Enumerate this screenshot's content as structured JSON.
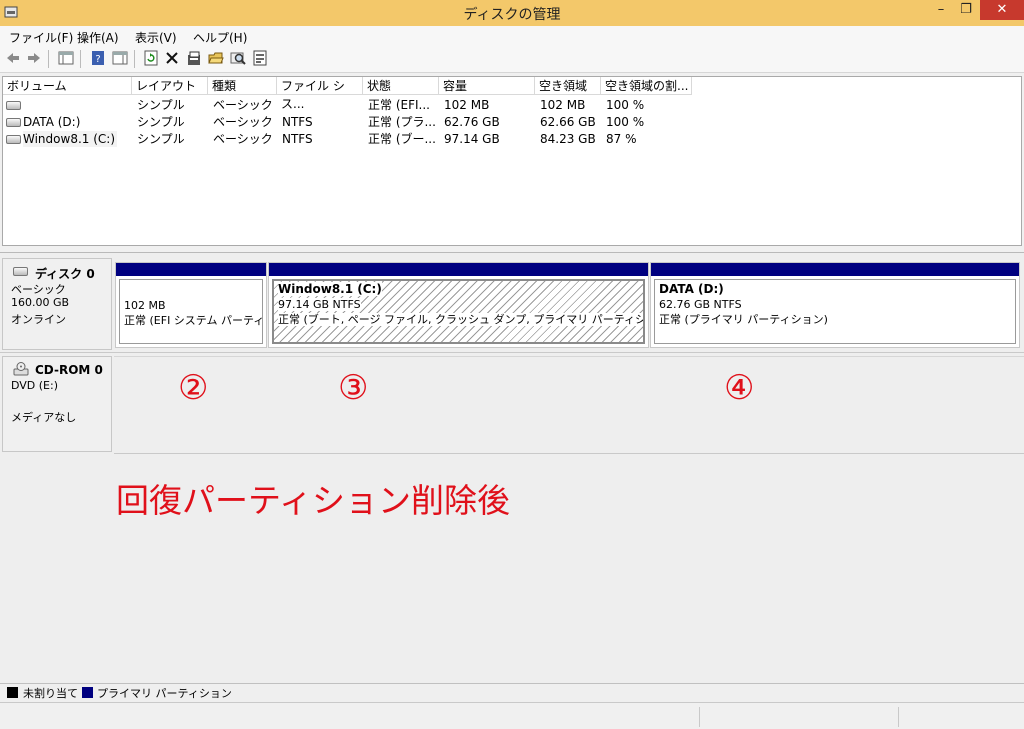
{
  "window": {
    "title": "ディスクの管理",
    "minimize": "–",
    "maximize": "❐",
    "close": "✕"
  },
  "menu": [
    "ファイル(F)",
    "操作(A)",
    "表示(V)",
    "ヘルプ(H)"
  ],
  "toolbar_icons": [
    "back-icon",
    "forward-icon",
    "console-tree-icon",
    "help-icon",
    "properties-pane-icon",
    "refresh-icon",
    "delete-icon",
    "properties-icon",
    "open-icon",
    "explore-icon",
    "rescan-icon"
  ],
  "volume_list": {
    "columns": [
      "ボリューム",
      "レイアウト",
      "種類",
      "ファイル シス...",
      "状態",
      "容量",
      "空き領域",
      "空き領域の割..."
    ],
    "rows": [
      {
        "volume": "",
        "layout": "シンプル",
        "type": "ベーシック",
        "fs": "",
        "status": "正常 (EFI...",
        "capacity": "102 MB",
        "free": "102 MB",
        "pct": "100 %"
      },
      {
        "volume": "DATA (D:)",
        "layout": "シンプル",
        "type": "ベーシック",
        "fs": "NTFS",
        "status": "正常 (プラ...",
        "capacity": "62.76 GB",
        "free": "62.66 GB",
        "pct": "100 %"
      },
      {
        "volume": "Window8.1 (C:)",
        "layout": "シンプル",
        "type": "ベーシック",
        "fs": "NTFS",
        "status": "正常 (ブー...",
        "capacity": "97.14 GB",
        "free": "84.23 GB",
        "pct": "87 %"
      }
    ]
  },
  "disks": [
    {
      "name": "ディスク 0",
      "lines": [
        "ベーシック",
        "160.00 GB",
        "オンライン"
      ],
      "partitions": [
        {
          "name": "",
          "size": "102 MB",
          "status": "正常 (EFI システム パーティシ"
        },
        {
          "name": "Window8.1  (C:)",
          "size": "97.14 GB NTFS",
          "status": "正常 (ブート, ページ ファイル, クラッシュ ダンプ, プライマリ パーティション)"
        },
        {
          "name": "DATA  (D:)",
          "size": "62.76 GB NTFS",
          "status": "正常 (プライマリ パーティション)"
        }
      ]
    },
    {
      "name": "CD-ROM 0",
      "lines": [
        "DVD (E:)",
        "",
        "メディアなし"
      ]
    }
  ],
  "annotations": {
    "n2": "②",
    "n3": "③",
    "n4": "④",
    "caption": "回復パーティション削除後"
  },
  "legend": {
    "unallocated": "未割り当て",
    "primary": "プライマリ パーティション"
  },
  "colors": {
    "titlebar": "#f3c86a",
    "partition_bar": "#000080",
    "annotation": "#e0101a",
    "close_button": "#c7392d"
  }
}
